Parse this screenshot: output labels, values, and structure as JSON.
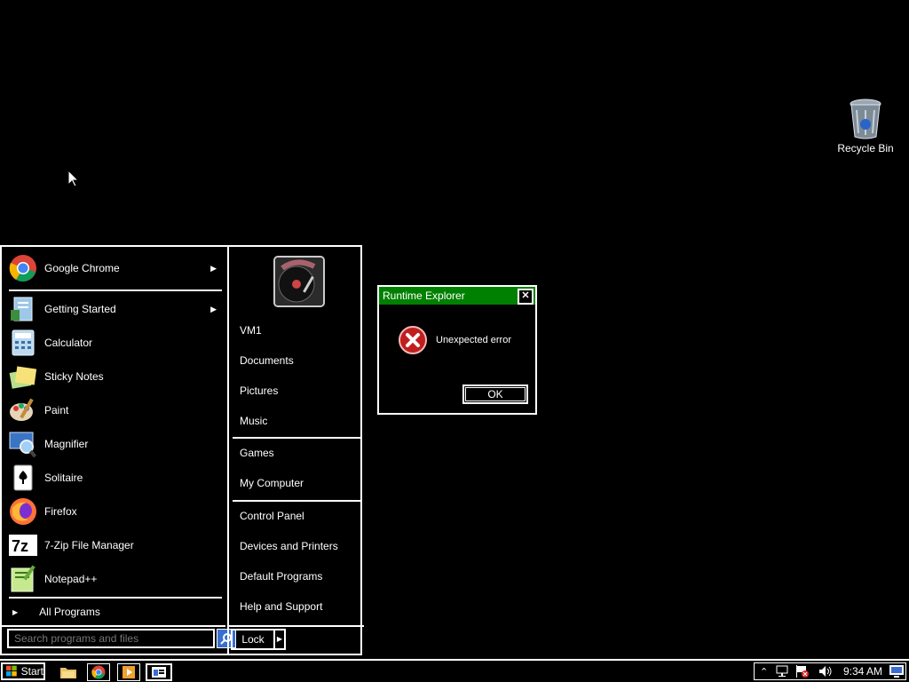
{
  "desktop": {
    "recycle_bin_label": "Recycle Bin"
  },
  "start_menu": {
    "programs": [
      {
        "label": "Google Chrome",
        "icon": "chrome-icon",
        "has_submenu": true
      },
      {
        "label": "Getting Started",
        "icon": "getting-started-icon",
        "has_submenu": true
      },
      {
        "label": "Calculator",
        "icon": "calculator-icon",
        "has_submenu": false
      },
      {
        "label": "Sticky Notes",
        "icon": "sticky-notes-icon",
        "has_submenu": false
      },
      {
        "label": "Paint",
        "icon": "paint-icon",
        "has_submenu": false
      },
      {
        "label": "Magnifier",
        "icon": "magnifier-icon",
        "has_submenu": false
      },
      {
        "label": "Solitaire",
        "icon": "solitaire-icon",
        "has_submenu": false
      },
      {
        "label": "Firefox",
        "icon": "firefox-icon",
        "has_submenu": false
      },
      {
        "label": "7-Zip File Manager",
        "icon": "7zip-icon",
        "has_submenu": false
      },
      {
        "label": "Notepad++",
        "icon": "notepadpp-icon",
        "has_submenu": false
      }
    ],
    "all_programs_label": "All Programs",
    "search_placeholder": "Search programs and files",
    "right_items": [
      {
        "label": "VM1"
      },
      {
        "label": "Documents"
      },
      {
        "label": "Pictures"
      },
      {
        "label": "Music"
      },
      {
        "label": "Games"
      },
      {
        "label": "My Computer"
      },
      {
        "label": "Control Panel"
      },
      {
        "label": "Devices and Printers"
      },
      {
        "label": "Default Programs"
      },
      {
        "label": "Help and Support"
      }
    ],
    "lock_label": "Lock"
  },
  "dialog": {
    "title": "Runtime Explorer",
    "message": "Unexpected error",
    "ok_label": "OK",
    "close_glyph": "✕"
  },
  "taskbar": {
    "start_label": "Start",
    "clock": "9:34 AM"
  },
  "colors": {
    "dialog_title_bg": "#008000",
    "search_button": "#3a6fd1"
  }
}
